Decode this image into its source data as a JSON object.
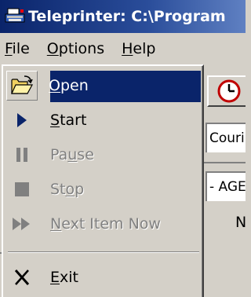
{
  "window": {
    "title": "Teleprinter: C:\\Program"
  },
  "menubar": {
    "items": [
      {
        "label": "File",
        "mnemonic": "F",
        "rest": "ile"
      },
      {
        "label": "Options",
        "mnemonic": "O",
        "rest": "ptions"
      },
      {
        "label": "Help",
        "mnemonic": "H",
        "rest": "elp"
      }
    ]
  },
  "file_menu": {
    "items": [
      {
        "label": "Open",
        "pre": "",
        "mnemonic": "O",
        "post": "pen",
        "icon": "open-folder-icon",
        "state": "highlighted"
      },
      {
        "label": "Start",
        "pre": "",
        "mnemonic": "S",
        "post": "tart",
        "icon": "play-icon",
        "state": "enabled"
      },
      {
        "label": "Pause",
        "pre": "Pa",
        "mnemonic": "u",
        "post": "se",
        "icon": "pause-icon",
        "state": "disabled"
      },
      {
        "label": "Stop",
        "pre": "St",
        "mnemonic": "o",
        "post": "p",
        "icon": "stop-icon",
        "state": "disabled"
      },
      {
        "label": "Next Item Now",
        "pre": "",
        "mnemonic": "N",
        "post": "ext Item Now",
        "icon": "fast-forward-icon",
        "state": "disabled"
      },
      {
        "label": "Exit",
        "pre": "",
        "mnemonic": "E",
        "post": "xit",
        "icon": "close-x-icon",
        "state": "enabled"
      }
    ]
  },
  "background": {
    "font_field": "Couri",
    "age_field": "- AGE",
    "letter": "N"
  },
  "colors": {
    "highlight": "#0a246a",
    "menu_bg": "#d4d0c8",
    "play_blue": "#0a246a",
    "disabled_gray": "#808080"
  }
}
